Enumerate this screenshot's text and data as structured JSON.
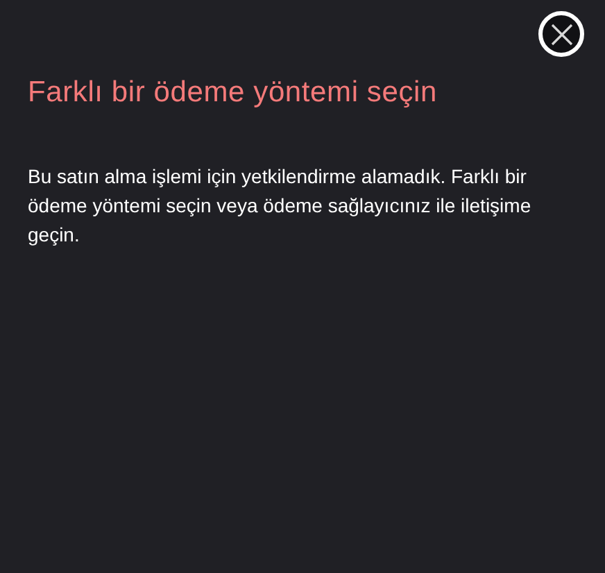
{
  "dialog": {
    "title": "Farklı bir ödeme yöntemi seçin",
    "message": "Bu satın alma işlemi için yetkilendirme alamadık. Farklı bir ödeme yöntemi seçin veya ödeme sağlayıcınız ile iletişime geçin."
  }
}
